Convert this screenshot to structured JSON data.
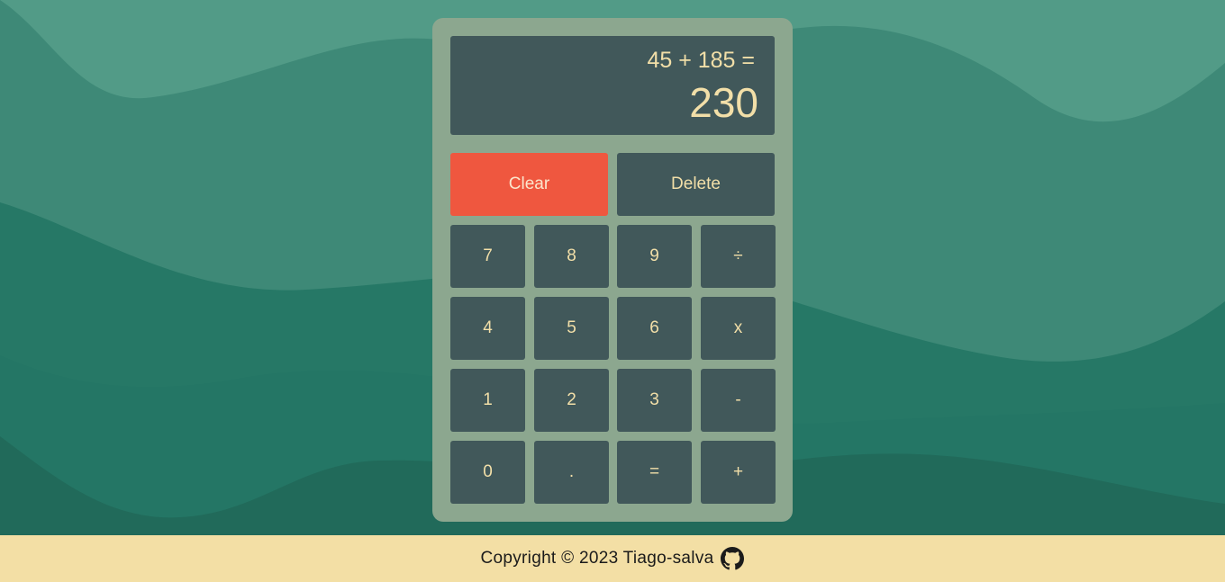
{
  "display": {
    "previous": "45 + 185 =",
    "current": "230"
  },
  "actions": {
    "clear": "Clear",
    "delete": "Delete"
  },
  "keys": {
    "seven": "7",
    "eight": "8",
    "nine": "9",
    "divide": "÷",
    "four": "4",
    "five": "5",
    "six": "6",
    "multiply": "x",
    "one": "1",
    "two": "2",
    "three": "3",
    "subtract": "-",
    "zero": "0",
    "decimal": ".",
    "equals": "=",
    "add": "+"
  },
  "footer": {
    "text": "Copyright © 2023 Tiago-salva",
    "icon": "github-icon"
  },
  "colors": {
    "background": "#529b87",
    "panel": "#8ca78f",
    "key": "#41585a",
    "key_text": "#f2dfa8",
    "clear": "#ef573f",
    "footer": "#f3dfa5"
  }
}
